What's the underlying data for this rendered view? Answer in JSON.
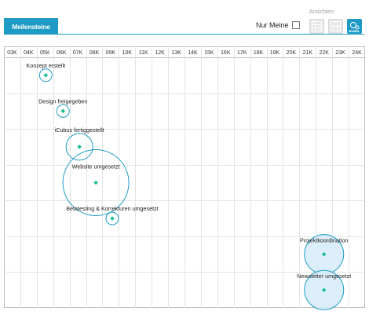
{
  "tab": {
    "label": "Meilensteine"
  },
  "filter": {
    "label": "Nur Meine",
    "checked": false
  },
  "views": {
    "label": "Ansichten:",
    "buttons": [
      {
        "name": "table-view",
        "label": ""
      },
      {
        "name": "grid-view",
        "label": ""
      },
      {
        "name": "bubble-view",
        "label": "BUBBL",
        "active": true
      }
    ]
  },
  "colors": {
    "accent": "#1d9bc4",
    "marker": "#1fbf98",
    "bubble_fill": "#d8ecfa",
    "bubble_stroke": "#1d9bc4"
  },
  "chart_data": {
    "type": "scatter",
    "x_ticks": [
      "03K",
      "04K",
      "05K",
      "06K",
      "07K",
      "08K",
      "09K",
      "10K",
      "11K",
      "12K",
      "13K",
      "14K",
      "15K",
      "16K",
      "17K",
      "18K",
      "19K",
      "20K",
      "21K",
      "22K",
      "23K",
      "24K"
    ],
    "points": [
      {
        "label": "Konzept erstellt",
        "x": 5.05,
        "size": "small",
        "filled": false
      },
      {
        "label": "Design freigegeben",
        "x": 6.1,
        "size": "small",
        "filled": false
      },
      {
        "label": "iCubus fertiggestellt",
        "x": 7.1,
        "size": "medium",
        "filled": false
      },
      {
        "label": "Website umgesetzt",
        "x": 8.1,
        "size": "large",
        "filled": false
      },
      {
        "label": "Betatesting & Korrekturen umgesetzt",
        "x": 9.1,
        "size": "small",
        "filled": false
      },
      {
        "label": "Projektkoordination",
        "x": 22.0,
        "size": "medium-large",
        "filled": true
      },
      {
        "label": "Newsletter umgesetzt",
        "x": 22.0,
        "size": "medium-large",
        "filled": true
      }
    ]
  }
}
